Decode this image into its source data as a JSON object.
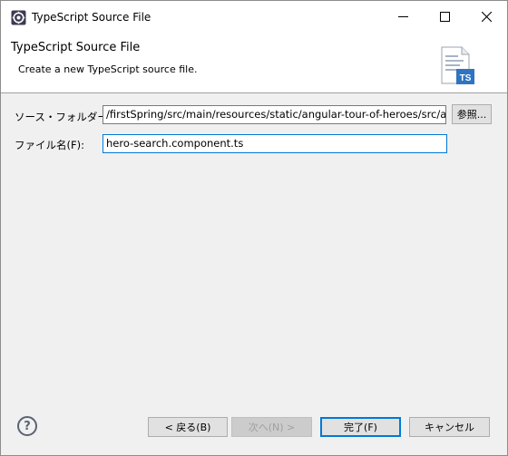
{
  "window": {
    "title": "TypeScript Source File",
    "icons": {
      "app": "eclipse-gear-icon",
      "minimize": "minimize-icon",
      "maximize": "maximize-icon",
      "close": "close-icon"
    }
  },
  "banner": {
    "title": "TypeScript Source File",
    "description": "Create a new TypeScript source file.",
    "icon": "typescript-file-icon",
    "icon_badge": "TS"
  },
  "form": {
    "source_folder": {
      "label": "ソース・フォルダー(S):",
      "value": "/firstSpring/src/main/resources/static/angular-tour-of-heroes/src/app",
      "browse_label": "参照..."
    },
    "file_name": {
      "label": "ファイル名(F):",
      "value": "hero-search.component.ts"
    }
  },
  "footer": {
    "help_glyph": "?",
    "back_label": "< 戻る(B)",
    "next_label": "次へ(N) >",
    "finish_label": "完了(F)",
    "cancel_label": "キャンセル"
  },
  "colors": {
    "accent": "#0078d7",
    "ts_badge": "#2f74c0"
  }
}
